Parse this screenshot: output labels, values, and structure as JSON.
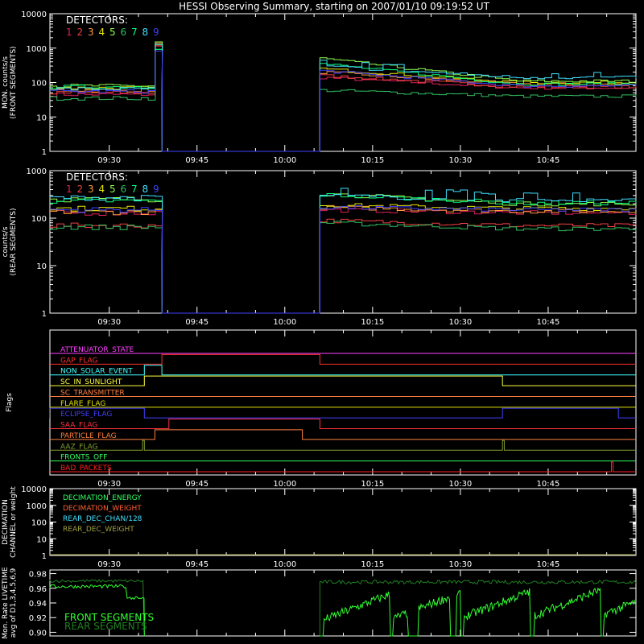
{
  "title": "HESSI Observing Summary, starting on 2007/01/10 09:19:52 UT",
  "colors": {
    "det": [
      "#e0205a",
      "#f04040",
      "#ff9a40",
      "#e8e800",
      "#90ff50",
      "#30c060",
      "#00ff80",
      "#40e0ff",
      "#4040ff"
    ],
    "axis": "#ffffff"
  },
  "time_ticks": [
    "09:30",
    "09:45",
    "10:00",
    "10:15",
    "10:30",
    "10:45"
  ],
  "chart_data": [
    {
      "type": "line",
      "name": "front",
      "ylabel": "MON. counts/s\n(FRONT SEGMENTS)",
      "log": true,
      "ylim": [
        1,
        10000
      ],
      "y_ticks": [
        "1",
        "10",
        "100",
        "1000",
        "10000"
      ],
      "legend_title": "DETECTORS:",
      "legend_numbers": [
        "1",
        "2",
        "3",
        "4",
        "5",
        "6",
        "7",
        "8",
        "9"
      ],
      "series": [
        {
          "det": 1,
          "pre": 45,
          "spike": 1100,
          "post_start": 140,
          "post_end": 70
        },
        {
          "det": 2,
          "pre": 50,
          "spike": 1200,
          "post_start": 160,
          "post_end": 75
        },
        {
          "det": 3,
          "pre": 60,
          "spike": 1300,
          "post_start": 200,
          "post_end": 90
        },
        {
          "det": 4,
          "pre": 70,
          "spike": 1400,
          "post_start": 250,
          "post_end": 100
        },
        {
          "det": 5,
          "pre": 80,
          "spike": 1500,
          "post_start": 500,
          "post_end": 110
        },
        {
          "det": 6,
          "pre": 35,
          "spike": 900,
          "post_start": 60,
          "post_end": 40
        },
        {
          "det": 7,
          "pre": 75,
          "spike": 1000,
          "post_start": 350,
          "post_end": 90
        },
        {
          "det": 8,
          "pre": 65,
          "spike": 1200,
          "post_start": 300,
          "post_end": 140
        },
        {
          "det": 9,
          "pre": 55,
          "spike": 800,
          "post_start": 220,
          "post_end": 80
        }
      ]
    },
    {
      "type": "line",
      "name": "rear",
      "ylabel": "counts/s\n(REAR SEGMENTS)",
      "log": true,
      "ylim": [
        1,
        1000
      ],
      "y_ticks": [
        "1",
        "10",
        "100",
        "1000"
      ],
      "legend_title": "DETECTORS:",
      "legend_numbers": [
        "1",
        "2",
        "3",
        "4",
        "5",
        "6",
        "7",
        "8",
        "9"
      ],
      "series": [
        {
          "det": 1,
          "pre": 130,
          "post_start": 150,
          "post_end": 130
        },
        {
          "det": 2,
          "pre": 70,
          "post_start": 90,
          "post_end": 70
        },
        {
          "det": 3,
          "pre": 135,
          "post_start": 170,
          "post_end": 140
        },
        {
          "det": 4,
          "pre": 160,
          "post_start": 190,
          "post_end": 160
        },
        {
          "det": 5,
          "pre": 250,
          "post_start": 330,
          "post_end": 200
        },
        {
          "det": 6,
          "pre": 65,
          "post_start": 80,
          "post_end": 60
        },
        {
          "det": 7,
          "pre": 230,
          "post_start": 310,
          "post_end": 210
        },
        {
          "det": 8,
          "pre": 270,
          "post_start": 300,
          "post_end": 240
        },
        {
          "det": 9,
          "pre": 150,
          "post_start": 170,
          "post_end": 150
        }
      ]
    },
    {
      "type": "line",
      "name": "flags",
      "ylabel": "Flags",
      "flags": [
        {
          "label": "ATTENUATOR_STATE",
          "color": "#ff40ff",
          "highs": []
        },
        {
          "label": "GAP_FLAG",
          "color": "#ff3030",
          "highs": [
            [
              9.65,
              10.1
            ]
          ]
        },
        {
          "label": "NON_SOLAR_EVENT",
          "color": "#40ffff",
          "highs": [
            [
              9.6,
              9.65
            ]
          ]
        },
        {
          "label": "SC_IN_SUNLIGHT",
          "color": "#ffff40",
          "highs": [
            [
              9.6,
              10.62
            ]
          ]
        },
        {
          "label": "SC_TRANSMITTER",
          "color": "#ff8040",
          "highs": []
        },
        {
          "label": "FLARE_FLAG",
          "color": "#e0e000",
          "highs": []
        },
        {
          "label": "ECLIPSE_FLAG",
          "color": "#4040ff",
          "highs": [
            [
              9.33,
              9.6
            ],
            [
              10.62,
              10.95
            ]
          ]
        },
        {
          "label": "SAA_FLAG",
          "color": "#ff3040",
          "highs": [
            [
              9.67,
              10.1
            ]
          ]
        },
        {
          "label": "PARTICLE_FLAG",
          "color": "#ff8040",
          "highs": [
            [
              9.63,
              10.05
            ]
          ]
        },
        {
          "label": "AAZ_FLAG",
          "color": "#80a030",
          "highs": [
            [
              9.595,
              9.6
            ],
            [
              10.62,
              10.625
            ]
          ]
        },
        {
          "label": "FRONTS_OFF",
          "color": "#30ff60",
          "highs": []
        },
        {
          "label": "BAD_PACKETS",
          "color": "#ff2020",
          "highs": [
            [
              10.93,
              10.935
            ]
          ]
        }
      ]
    },
    {
      "type": "line",
      "name": "decimation",
      "ylabel": "DECIMATION\nCHANNEL or weight",
      "log": true,
      "ylim": [
        1,
        10000
      ],
      "y_ticks": [
        "1",
        "10",
        "100",
        "1000",
        "10000"
      ],
      "legend": [
        {
          "label": "DECIMATION_ENERGY",
          "color": "#30ff60"
        },
        {
          "label": "DECIMATION_WEIGHT",
          "color": "#ff6030"
        },
        {
          "label": "REAR_DEC_CHAN/128",
          "color": "#40e0ff"
        },
        {
          "label": "REAR_DEC_WEIGHT",
          "color": "#a0a040"
        }
      ]
    },
    {
      "type": "line",
      "name": "livetime",
      "ylabel": "Mon. Rate LIVETIME\navg of D1,3,4,5,6,9",
      "ylim": [
        0.895,
        0.985
      ],
      "y_ticks": [
        "0.90",
        "0.92",
        "0.94",
        "0.96",
        "0.98"
      ],
      "legend": [
        {
          "label": "FRONT SEGMENTS",
          "color": "#30ff30"
        },
        {
          "label": "REAR SEGMENTS",
          "color": "#208020"
        }
      ]
    }
  ]
}
